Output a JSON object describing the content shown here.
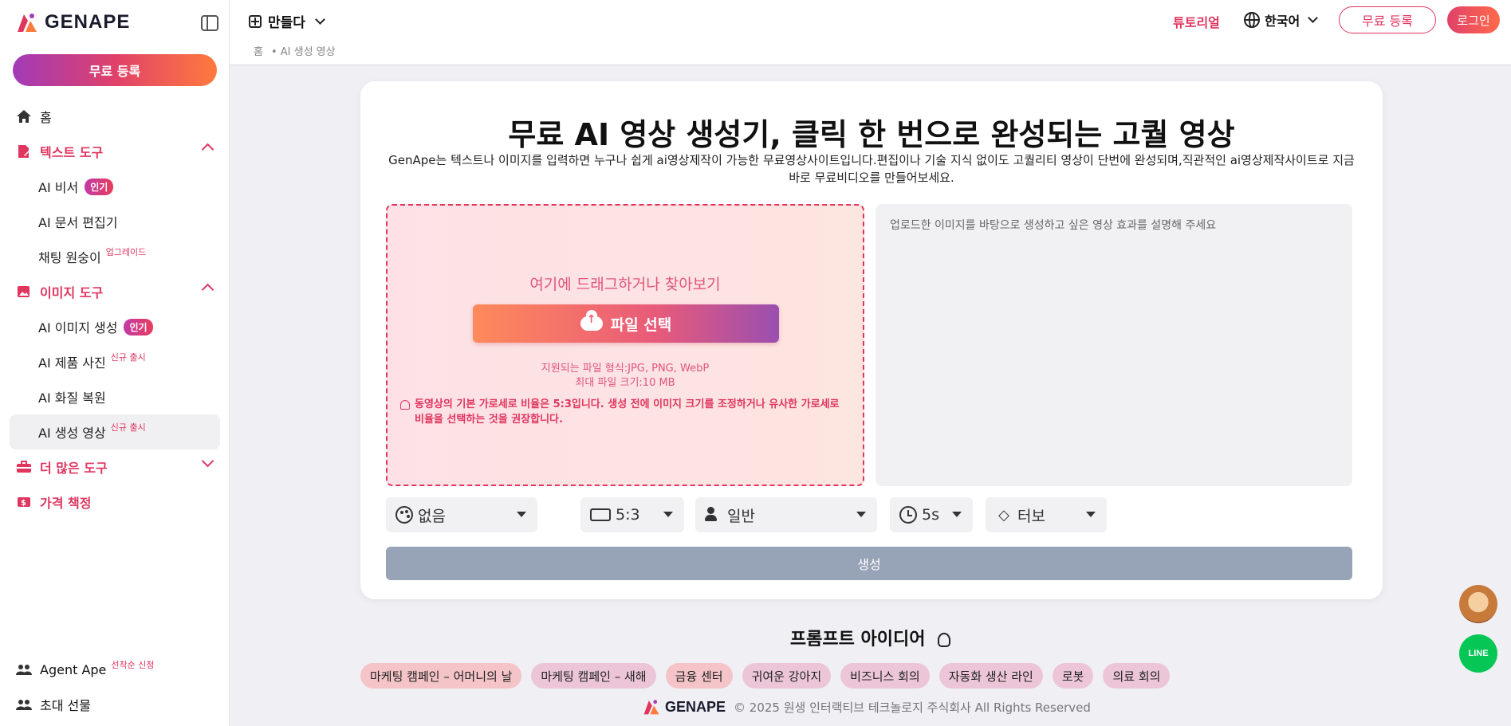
{
  "brand": {
    "name": "GENAPE",
    "accent": "#e0355f",
    "gradient_start": "#a13bb8",
    "gradient_end": "#ff7a3d"
  },
  "sidebar": {
    "signup_label": "무료 등록",
    "home": "홈",
    "text_tools": {
      "label": "텍스트 도구",
      "items": [
        {
          "label": "AI 비서",
          "badge": "인기"
        },
        {
          "label": "AI 문서 편집기"
        },
        {
          "label": "채팅 원숭이",
          "tag": "업그레이드"
        }
      ]
    },
    "image_tools": {
      "label": "이미지 도구",
      "items": [
        {
          "label": "AI 이미지 생성",
          "badge": "인기"
        },
        {
          "label": "AI 제품 사진",
          "tag": "신규 출시"
        },
        {
          "label": "AI 화질 복원"
        },
        {
          "label": "AI 생성 영상",
          "tag": "신규 출시"
        }
      ]
    },
    "more_tools": "더 많은 도구",
    "pricing": "가격 책정",
    "agent_ape": {
      "label": "Agent Ape",
      "tag": "선착순 신청"
    },
    "invite": "초대 선물"
  },
  "topbar": {
    "create_menu": "만들다",
    "breadcrumb": [
      "홈",
      "• AI 생성 영상"
    ],
    "tutorial": "튜토리얼",
    "language": "한국어",
    "signup": "무료 등록",
    "login": "로그인"
  },
  "main": {
    "title": "무료 AI 영상 생성기, 클릭 한 번으로 완성되는 고퀄 영상",
    "subtitle": "GenApe는 텍스트나 이미지를 입력하면 누구나 쉽게 ai영상제작이 가능한 무료영상사이트입니다.편집이나 기술 지식 없이도 고퀄리티 영상이 단번에 완성되며,직관적인 ai영상제작사이트로 지금 바로 무료비디오를 만들어보세요.",
    "dropzone": {
      "prompt": "여기에 드래그하거나 찾아보기",
      "button": "파일 선택",
      "formats": "지원되는 파일 형식:JPG, PNG, WebP",
      "max_size": "최대 파일 크기:10 MB",
      "warning_pre": "동영상의 기본 가로세로 비율은 ",
      "warning_ratio": "5:3",
      "warning_post": "입니다. 생성 전에 이미지 크기를 조정하거나 유사한 가로세로 비율을 선택하는 것을 권장합니다."
    },
    "prompt_placeholder": "업로드한 이미지를 바탕으로 생성하고 싶은 영상 효과를 설명해 주세요",
    "options": {
      "style": "없음",
      "ratio": "5:3",
      "mode": "일반",
      "duration": "5s",
      "speed": "터보"
    },
    "generate": "생성"
  },
  "ideas": {
    "title": "프롬프트 아이디어",
    "chips": [
      "마케팅 캠페인 – 어머니의 날",
      "마케팅 캠페인 – 새해",
      "금융 센터",
      "귀여운 강아지",
      "비즈니스 회의",
      "자동화 생산 라인",
      "로봇",
      "의료 회의"
    ]
  },
  "footer": {
    "logo": "GENAPE",
    "copyright": "© 2025 원생 인터랙티브 테크놀로지 주식회사 All Rights Reserved"
  },
  "floating": {
    "line": "LINE"
  }
}
